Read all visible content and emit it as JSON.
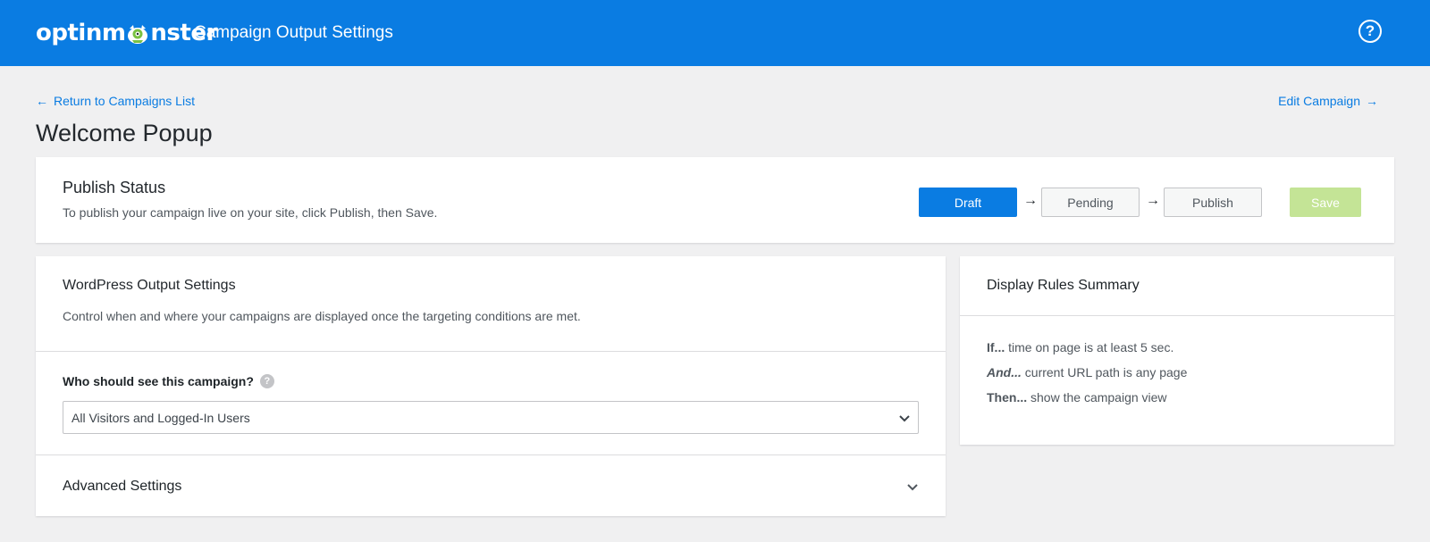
{
  "header": {
    "logo_text_left": "optinm",
    "logo_text_right": "nster",
    "title": "Campaign Output Settings",
    "help_symbol": "?",
    "help_icon": "help-circle-icon",
    "brand_color": "#0a7ce2"
  },
  "nav": {
    "back_arrow": "←",
    "back_label": "Return to Campaigns List",
    "edit_label": "Edit Campaign",
    "edit_arrow": "→"
  },
  "page": {
    "title": "Welcome Popup"
  },
  "publish": {
    "title": "Publish Status",
    "description": "To publish your campaign live on your site, click Publish, then Save.",
    "steps": [
      "Draft",
      "Pending",
      "Publish"
    ],
    "active_step": "Draft",
    "step_arrow": "→",
    "save_label": "Save",
    "save_color": "#c4e496"
  },
  "output": {
    "title": "WordPress Output Settings",
    "description": "Control when and where your campaigns are displayed once the targeting conditions are met.",
    "who_label": "Who should see this campaign?",
    "who_help": "?",
    "who_value": "All Visitors and Logged-In Users",
    "advanced_title": "Advanced Settings"
  },
  "rules": {
    "title": "Display Rules Summary",
    "items": [
      {
        "keyword": "If...",
        "text": " time on page is at least 5 sec."
      },
      {
        "keyword": "And...",
        "text": " current URL path is any page"
      },
      {
        "keyword": "Then...",
        "text": " show the campaign view"
      }
    ]
  }
}
